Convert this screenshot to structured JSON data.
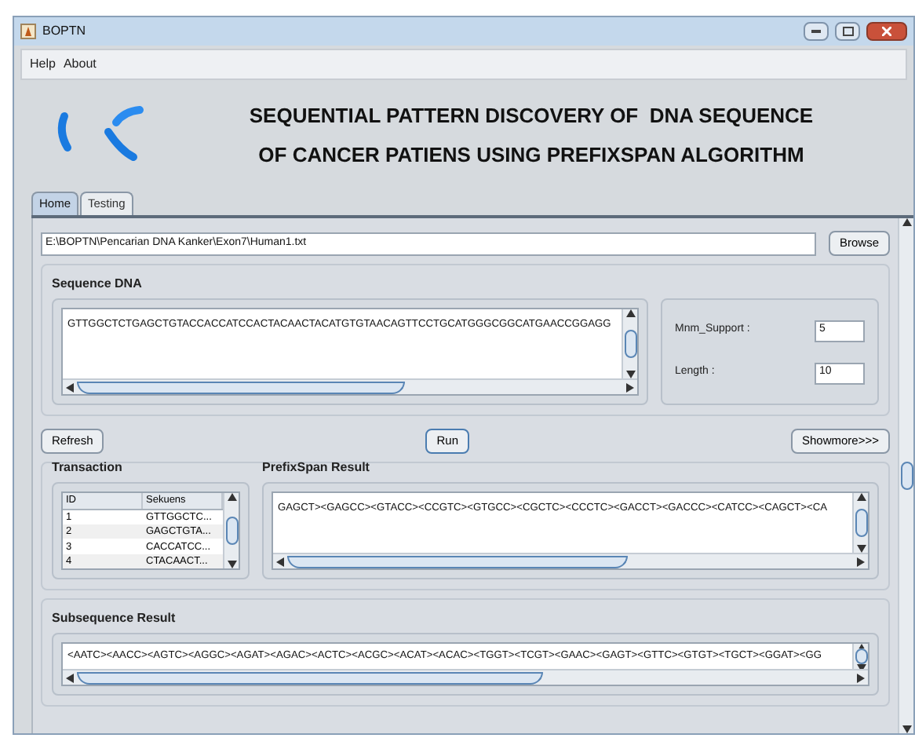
{
  "window": {
    "title": "BOPTN"
  },
  "menu": [
    "Help",
    "About"
  ],
  "header": {
    "title_lines": [
      "SEQUENTIAL PATTERN DISCOVERY OF  DNA SEQUENCE",
      "OF CANCER PATIENS USING PREFIXSPAN ALGORITHM"
    ]
  },
  "tabs": [
    {
      "label": "Home",
      "selected": true
    },
    {
      "label": "Testing",
      "selected": false
    }
  ],
  "file": {
    "value": "E:\\BOPTN\\Pencarian DNA Kanker\\Exon7\\Human1.txt",
    "button": "Browse"
  },
  "sequence": {
    "title": "Sequence DNA",
    "value": "GTTGGCTCTGAGCTGTACCACCATCCACTACAACTACATGTGTAACAGTTCCTGCATGGGCGGCATGAACCGGAGG"
  },
  "params": [
    {
      "label": "Mnm_Support :",
      "value": "5"
    },
    {
      "label": "Length :",
      "value": "10"
    }
  ],
  "buttons": [
    "Refresh",
    "Run",
    "Showmore>>>"
  ],
  "transaction": {
    "title": "Transaction",
    "columns": [
      "ID",
      "Sekuens"
    ],
    "rows": [
      [
        "1",
        "GTTGGCTC..."
      ],
      [
        "2",
        "GAGCTGTA..."
      ],
      [
        "3",
        "CACCATCC..."
      ],
      [
        "4",
        "CTACAACT..."
      ]
    ]
  },
  "prefixspan": {
    "title": "PrefixSpan Result",
    "value": "GAGCT><GAGCC><GTACC><CCGTC><GTGCC><CGCTC><CCCTC><GACCT><GACCC><CATCC><CAGCT><CA"
  },
  "subsequence": {
    "title": "Subsequence Result",
    "value": "<AATC><AACC><AGTC><AGGC><AGAT><AGAC><ACTC><ACGC><ACAT><ACAC><TGGT><TCGT><GAAC><GAGT><GTTC><GTGT><TGCT><GGAT><GG"
  }
}
